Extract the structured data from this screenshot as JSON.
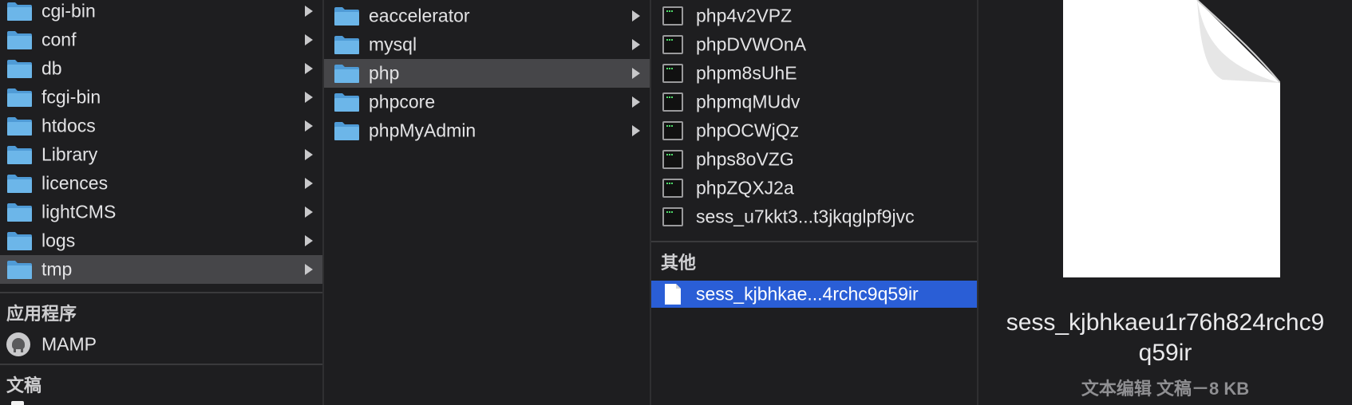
{
  "column1": {
    "items": [
      {
        "label": "cgi-bin"
      },
      {
        "label": "conf"
      },
      {
        "label": "db"
      },
      {
        "label": "fcgi-bin"
      },
      {
        "label": "htdocs"
      },
      {
        "label": "Library"
      },
      {
        "label": "licences"
      },
      {
        "label": "lightCMS"
      },
      {
        "label": "logs"
      },
      {
        "label": "tmp"
      }
    ],
    "section_apps": "应用程序",
    "app_item": "MAMP",
    "section_docs": "文稿"
  },
  "column2": {
    "items": [
      {
        "label": "eaccelerator"
      },
      {
        "label": "mysql"
      },
      {
        "label": "php"
      },
      {
        "label": "phpcore"
      },
      {
        "label": "phpMyAdmin"
      }
    ]
  },
  "column3": {
    "items": [
      {
        "label": "php4v2VPZ"
      },
      {
        "label": "phpDVWOnA"
      },
      {
        "label": "phpm8sUhE"
      },
      {
        "label": "phpmqMUdv"
      },
      {
        "label": "phpOCWjQz"
      },
      {
        "label": "phps8oVZG"
      },
      {
        "label": "phpZQXJ2a"
      },
      {
        "label": "sess_u7kkt3...t3jkqglpf9jvc"
      }
    ],
    "section_other": "其他",
    "selected_item": "sess_kjbhkae...4rchc9q59ir"
  },
  "preview": {
    "filename_line1": "sess_kjbhkaeu1r76h824rchc9",
    "filename_line2": "q59ir",
    "meta": "文本编辑 文稿－8 KB"
  },
  "colors": {
    "selection_blue": "#2a5ed6",
    "selection_gray": "#464649",
    "folder_blue": "#6cb6e9"
  }
}
